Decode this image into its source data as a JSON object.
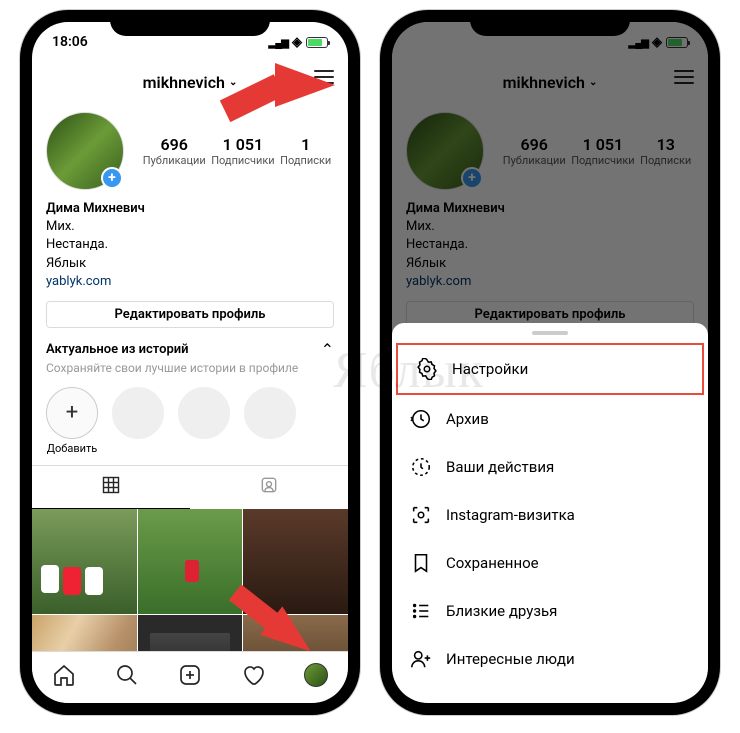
{
  "status": {
    "time": "18:06"
  },
  "header": {
    "username": "mikhnevich"
  },
  "stats": {
    "posts": {
      "number": "696",
      "label": "Публикации"
    },
    "followers": {
      "number": "1 051",
      "label": "Подписчики"
    },
    "following": {
      "number": "13",
      "label": "Подписки"
    },
    "following_trunc": {
      "number": "1",
      "label": "Подписки"
    }
  },
  "bio": {
    "name": "Дима Михневич",
    "line1": "Мих.",
    "line2": "Нестанда.",
    "line3": "Яблык",
    "link": "yablyk.com"
  },
  "edit_button": "Редактировать профиль",
  "highlights": {
    "title": "Актуальное из историй",
    "subtitle": "Сохраняйте свои лучшие истории в профиле",
    "add": "Добавить"
  },
  "menu": {
    "settings": "Настройки",
    "archive": "Архив",
    "activity": "Ваши действия",
    "nametag": "Instagram-визитка",
    "saved": "Сохраненное",
    "close_friends": "Близкие друзья",
    "discover": "Интересные люди"
  },
  "watermark": "Яблык"
}
